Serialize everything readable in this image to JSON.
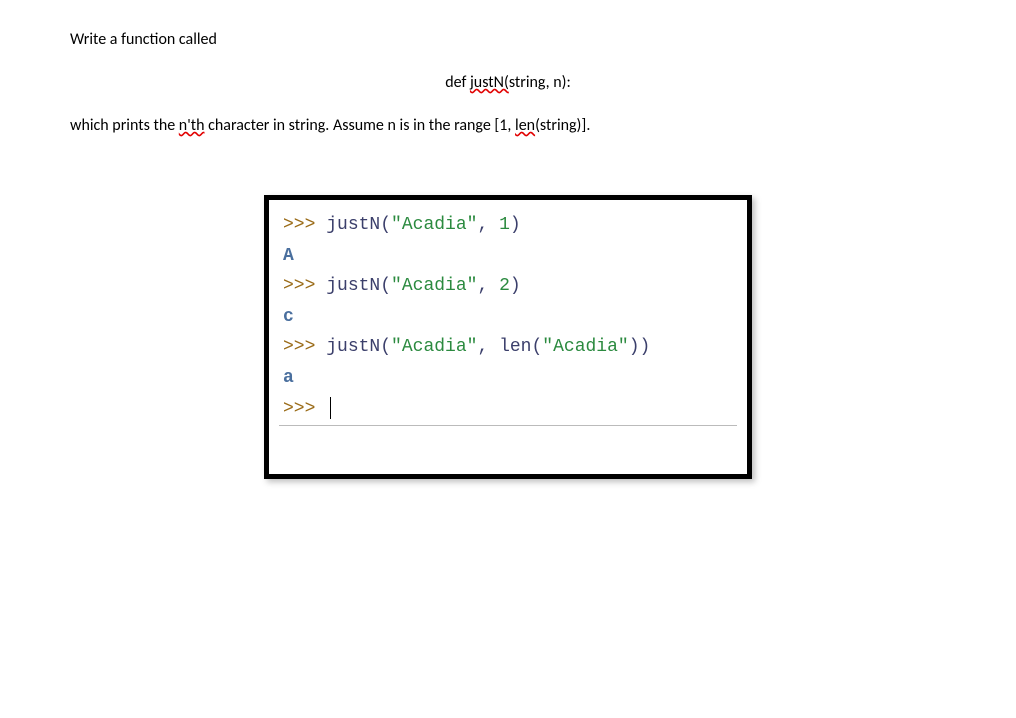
{
  "prose": {
    "intro": "Write a function called",
    "def_prefix": "def ",
    "def_fn": "justN(",
    "def_suffix": "string, n):",
    "desc_p1": "which prints the ",
    "desc_nth": "n'th",
    "desc_p2": " character in string. Assume n is in the range [1, ",
    "desc_len": "len",
    "desc_p3": "(string)]."
  },
  "terminal": {
    "prompt": ">>> ",
    "lines": [
      {
        "type": "input",
        "fn": "justN",
        "arg_str": "\"Acadia\"",
        "sep": ", ",
        "arg2_type": "num",
        "arg2": "1"
      },
      {
        "type": "output",
        "text": "A"
      },
      {
        "type": "input",
        "fn": "justN",
        "arg_str": "\"Acadia\"",
        "sep": ", ",
        "arg2_type": "num",
        "arg2": "2"
      },
      {
        "type": "output",
        "text": "c"
      },
      {
        "type": "input",
        "fn": "justN",
        "arg_str": "\"Acadia\"",
        "sep": ", ",
        "arg2_type": "call",
        "arg2_fn": "len",
        "arg2_arg": "\"Acadia\""
      },
      {
        "type": "output",
        "text": "a"
      },
      {
        "type": "prompt_only"
      }
    ]
  }
}
